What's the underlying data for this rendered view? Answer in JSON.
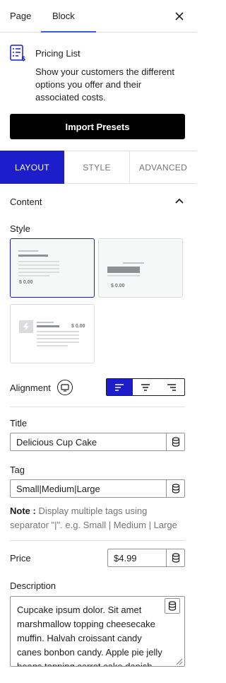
{
  "top_tabs": {
    "page": "Page",
    "block": "Block"
  },
  "block": {
    "name": "Pricing List",
    "description": "Show your customers the different options you offer and their associated costs.",
    "import_button": "Import Presets"
  },
  "inspector_tabs": {
    "layout": "LAYOUT",
    "style": "STYLE",
    "advanced": "ADVANCED"
  },
  "content_panel": {
    "title": "Content",
    "style_label": "Style",
    "style_options": [
      {
        "price": "$ 0.00",
        "selected": true
      },
      {
        "price": "$ 0.00",
        "selected": false
      },
      {
        "price": "$ 0.00",
        "selected": false
      }
    ],
    "alignment_label": "Alignment",
    "title_label": "Title",
    "title_value": "Delicious Cup Cake",
    "tag_label": "Tag",
    "tag_value": "Small|Medium|Large",
    "note_label": "Note :",
    "note_text": " Display multiple tags using separator \"|\". e.g. Small | Medium | Large",
    "price_label": "Price",
    "price_value": "$4.99",
    "description_label": "Description",
    "description_value": "Cupcake ipsum dolor. Sit amet marshmallow topping cheesecake muffin. Halvah croissant candy canes bonbon candy. Apple pie jelly beans topping carrot cake danish tart cake"
  },
  "colors": {
    "accent": "#1d1dcc",
    "wp_blue": "#3858e9",
    "button_black": "#000000"
  }
}
